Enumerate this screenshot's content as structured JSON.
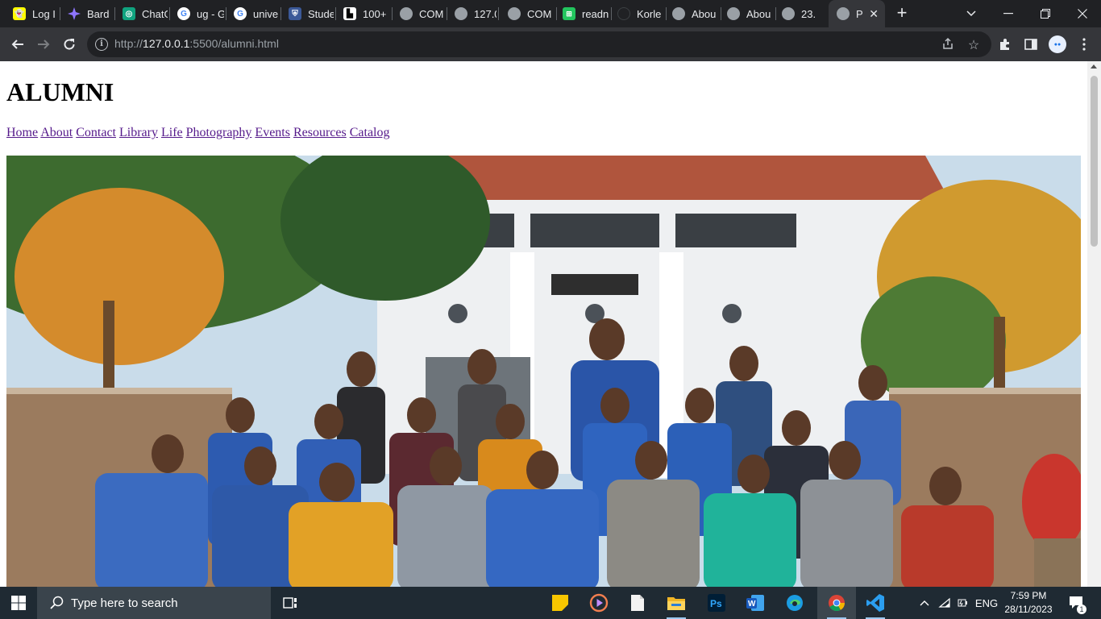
{
  "browser": {
    "tabs": [
      {
        "title": "Log I",
        "icon": "snapchat-icon",
        "color": "#fffc00"
      },
      {
        "title": "Bard",
        "icon": "bard-icon",
        "color": "#8e75ff"
      },
      {
        "title": "ChatG",
        "icon": "chatgpt-icon",
        "color": "#10a37f"
      },
      {
        "title": "ug - G",
        "icon": "google-icon",
        "color": "#ffffff"
      },
      {
        "title": "unive",
        "icon": "google-icon",
        "color": "#ffffff"
      },
      {
        "title": "Stude",
        "icon": "crest-icon",
        "color": "#3b5998"
      },
      {
        "title": "100+",
        "icon": "logo-icon",
        "color": "#ffffff"
      },
      {
        "title": "COM",
        "icon": "globe-icon",
        "color": "#9aa0a6"
      },
      {
        "title": "127.0",
        "icon": "globe-icon",
        "color": "#9aa0a6"
      },
      {
        "title": "COM",
        "icon": "globe-icon",
        "color": "#9aa0a6"
      },
      {
        "title": "readn",
        "icon": "readme-icon",
        "color": "#22c55e"
      },
      {
        "title": "Korle",
        "icon": "dark-circle-icon",
        "color": "#202124"
      },
      {
        "title": "Abou",
        "icon": "globe-icon",
        "color": "#9aa0a6"
      },
      {
        "title": "Abou",
        "icon": "globe-icon",
        "color": "#9aa0a6"
      },
      {
        "title": "23.",
        "icon": "globe-icon",
        "color": "#9aa0a6"
      },
      {
        "title": "P",
        "icon": "globe-icon",
        "color": "#9aa0a6",
        "active": true
      }
    ],
    "url_prefix": "http://",
    "url_host": "127.0.0.1",
    "url_path": ":5500/alumni.html"
  },
  "page": {
    "title": "ALUMNI",
    "nav": [
      "Home",
      "About",
      "Contact",
      "Library",
      "Life",
      "Photography",
      "Events",
      "Resources",
      "Catalog"
    ],
    "link_color": "#551a8b"
  },
  "taskbar": {
    "search_placeholder": "Type here to search",
    "language": "ENG",
    "time": "7:59 PM",
    "date": "28/11/2023",
    "notification_count": "1"
  }
}
